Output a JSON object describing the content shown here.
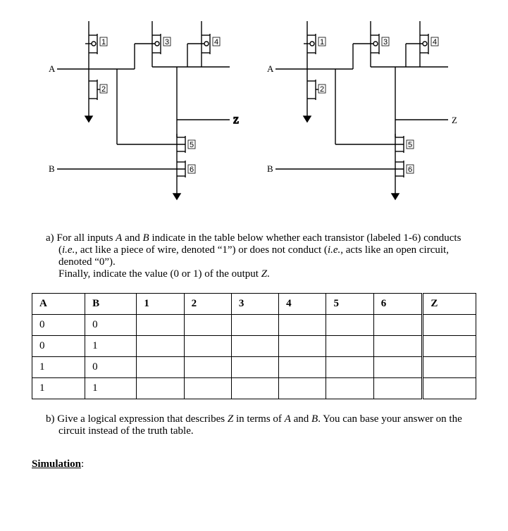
{
  "circuit": {
    "input_a": "A",
    "input_b": "B",
    "output_z": "Z",
    "transistor_labels": {
      "t1": "1",
      "t2": "2",
      "t3": "3",
      "t4": "4",
      "t5": "5",
      "t6": "6"
    }
  },
  "question_a": {
    "letter": "a)",
    "line1_prefix": "For all inputs ",
    "A": "A",
    "line1_mid": " and ",
    "B": "B",
    "line1_suffix": " indicate in the table below whether each transistor (labeled 1-6) conducts (",
    "ie1": "i.e.",
    "line2": ", act like a piece of wire, denoted “1”) or does not conduct (",
    "ie2": "i.e.",
    "line3": ", acts like an open circuit, denoted “0”).",
    "line4": "Finally, indicate the value (0 or 1) of the output ",
    "Z": "Z",
    "line5": "."
  },
  "table": {
    "headers": {
      "A": "A",
      "B": "B",
      "c1": "1",
      "c2": "2",
      "c3": "3",
      "c4": "4",
      "c5": "5",
      "c6": "6",
      "Z": "Z"
    },
    "rows": [
      {
        "A": "0",
        "B": "0",
        "c1": "",
        "c2": "",
        "c3": "",
        "c4": "",
        "c5": "",
        "c6": "",
        "Z": ""
      },
      {
        "A": "0",
        "B": "1",
        "c1": "",
        "c2": "",
        "c3": "",
        "c4": "",
        "c5": "",
        "c6": "",
        "Z": ""
      },
      {
        "A": "1",
        "B": "0",
        "c1": "",
        "c2": "",
        "c3": "",
        "c4": "",
        "c5": "",
        "c6": "",
        "Z": ""
      },
      {
        "A": "1",
        "B": "1",
        "c1": "",
        "c2": "",
        "c3": "",
        "c4": "",
        "c5": "",
        "c6": "",
        "Z": ""
      }
    ]
  },
  "question_b": {
    "letter": "b)",
    "l1_prefix": "Give a logical expression that describes ",
    "Z": "Z",
    "l1_mid": " in terms of ",
    "A": "A",
    "l1_and": " and ",
    "B": "B",
    "l1_suffix": ". You can base your answer on the circuit instead of the truth table."
  },
  "simulation_heading": "Simulation",
  "colon": ":"
}
